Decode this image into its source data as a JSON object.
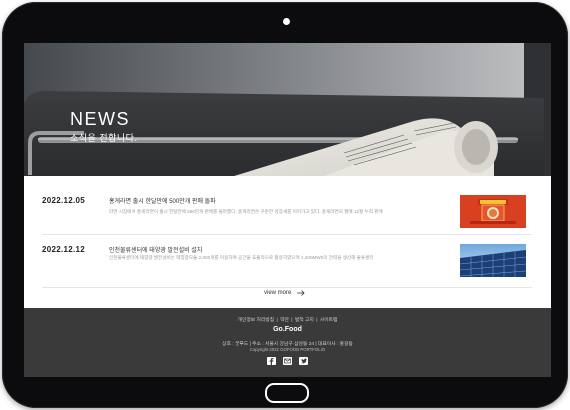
{
  "hero": {
    "title": "NEWS",
    "subtitle": "소식을 전합니다."
  },
  "news": [
    {
      "date": "2022.12.05",
      "title": "홍게라면 출시 한달만에 500만개 판매 돌파",
      "desc": "라면 시장에서 홍게라면이 출시 한달만에 500만개 판매를 돌파했다. 홍게라면은 꾸준한 성장세를 이어가고 있다. 홍게라면의 월매 12월 누적 판매",
      "thumb_icon": "ramen-thumbnail"
    },
    {
      "date": "2022.12.12",
      "title": "인천물류센터에 태양광 발전설비 설치",
      "desc": "인천물류센터에 태양광 발전설비는 태양광모듈 2,000개를 이용하여 공간을 효율적으로 활용하였으며 1,400MWh의 전력을 생산해 물류센터",
      "thumb_icon": "solar-panel-thumbnail"
    }
  ],
  "view_more": "view more",
  "footer": {
    "links": [
      "개인정보 처리방침",
      "약관",
      "법적 고지",
      "사이트맵"
    ],
    "brand": "Go.Food",
    "info": "상호 : 굿푸드 | 주소 : 서울시 강남구 삼성동 24 | 대표이사 : 홍길동",
    "copyright": "Copyright 2022 GOFOOD PORTFOLIO",
    "social": [
      "facebook-icon",
      "mail-icon",
      "twitter-icon"
    ]
  },
  "colors": {
    "footer_bg": "#3a3a3a",
    "device_frame": "#0c0c0e",
    "thumb_red": "#d9401f"
  }
}
